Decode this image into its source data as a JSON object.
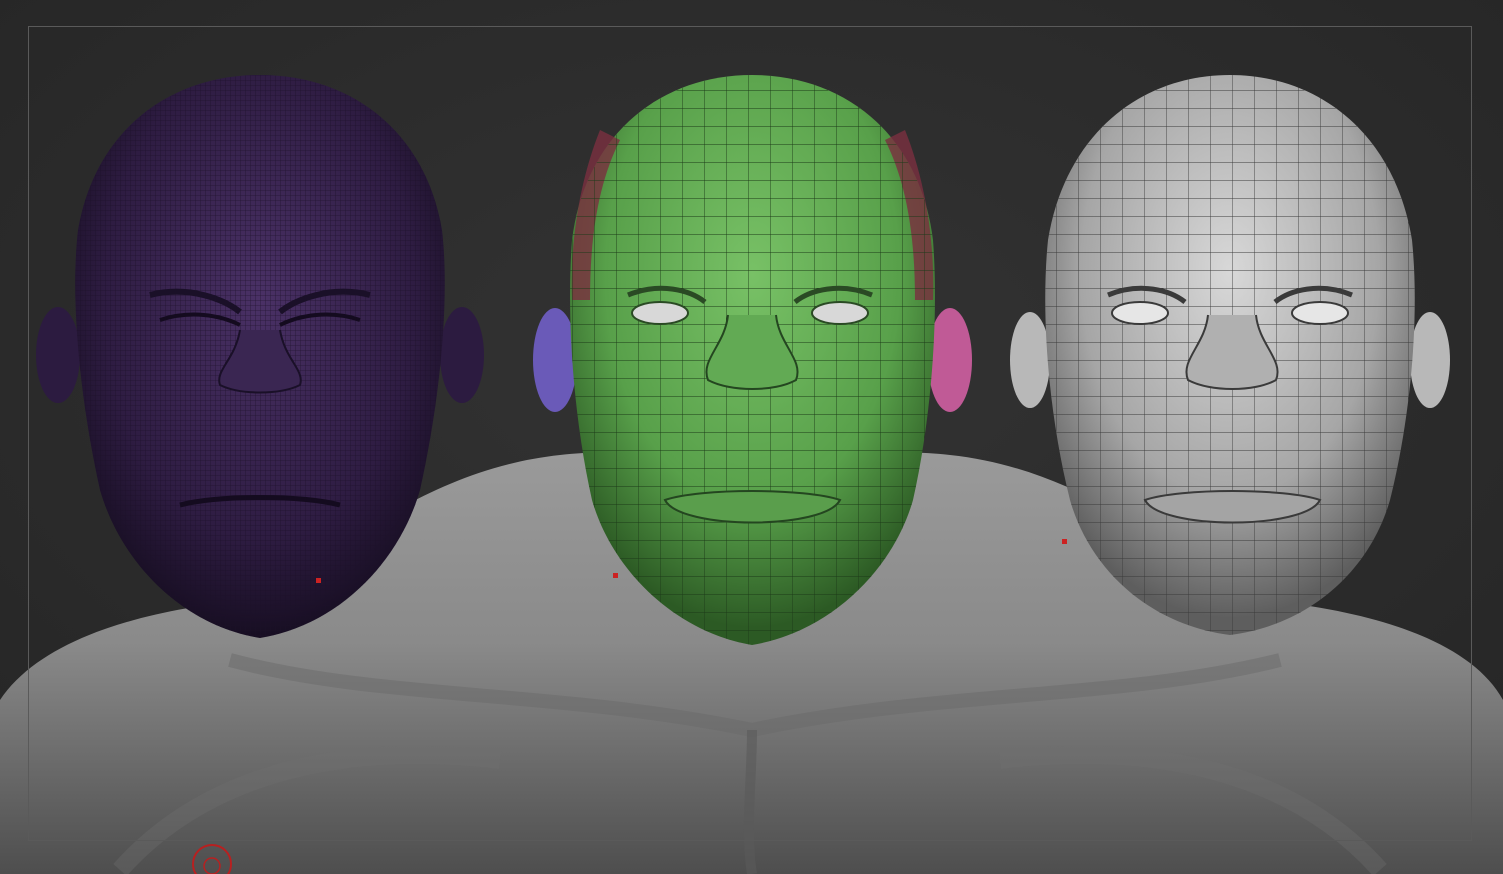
{
  "viewport": {
    "background": "#2c2c2c",
    "frame_color": "#5a5a5a"
  },
  "scene": {
    "models": [
      {
        "id": "highres-sculpt",
        "color": "#3a2450",
        "wire_color": "#221430",
        "wire": "dense"
      },
      {
        "id": "polygroup-retopo",
        "color": "#5fa552",
        "wire_color": "#1e3a1a",
        "wire": "medium"
      },
      {
        "id": "lowres-retopo",
        "color": "#a8a8a8",
        "wire_color": "#3c3c3c",
        "wire": "medium"
      }
    ],
    "torso_color": "#8a8a8a",
    "marker_color": "#cc2222"
  },
  "cursor": {
    "icon": "brush-cursor-icon",
    "color": "#b82020"
  }
}
